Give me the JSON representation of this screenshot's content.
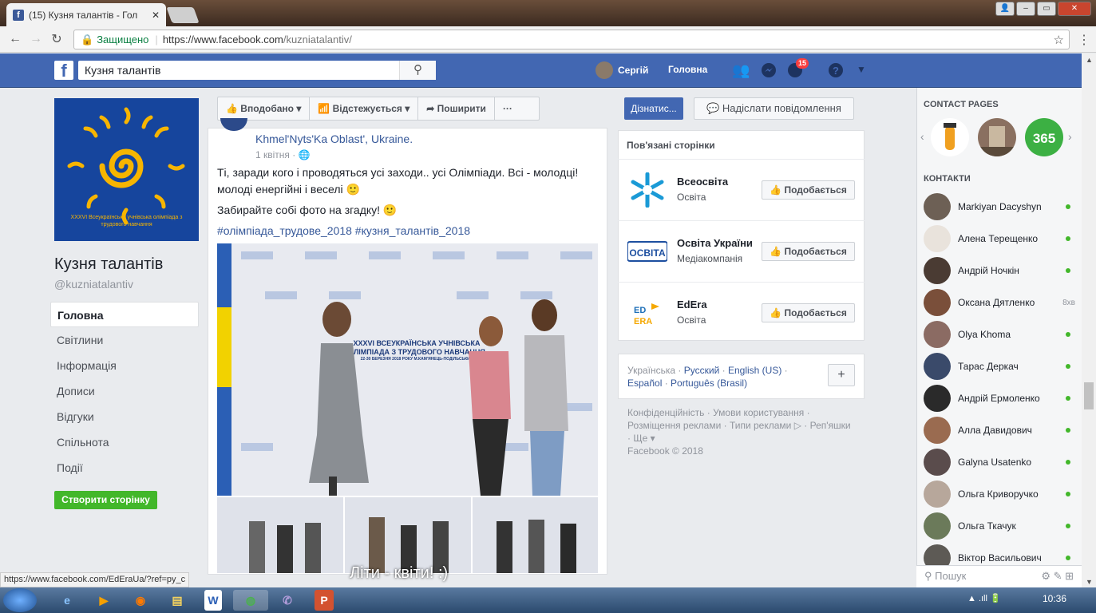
{
  "browser": {
    "tab_title": "(15) Кузня талантів - Гол",
    "secure_label": "Защищено",
    "url_host": "https://www.facebook.com",
    "url_path": "/kuzniatalantiv/",
    "status_url": "https://www.facebook.com/EdEraUa/?ref=py_c"
  },
  "topbar": {
    "search_value": "Кузня талантів",
    "user_name": "Сергій",
    "home_label": "Головна",
    "notif_count": "15"
  },
  "page": {
    "cover_text": "XXXVI Всеукраїнська учнівська олімпіада з трудового навчання",
    "name": "Кузня талантів",
    "handle": "@kuzniatalantiv",
    "nav": [
      "Головна",
      "Світлини",
      "Інформація",
      "Дописи",
      "Відгуки",
      "Спільнота",
      "Події"
    ],
    "create_page": "Створити сторінку"
  },
  "actions": {
    "liked": "Вподобано",
    "following": "Відстежується",
    "share": "Поширити",
    "more": "···",
    "learn_more": "Дізнатис...",
    "send_message": "Надіслати повідомлення"
  },
  "post": {
    "location": "Khmel'Nyts'Ka Oblast', Ukraine.",
    "date": "1 квітня",
    "text1": "Ті, заради кого і проводяться усі заходи.. усі Олімпіади. Всі - молодці! молоді енергійні і веселі 🙂",
    "text2": "Забирайте собі фото на згадку! 🙂",
    "tags": "#олімпіада_трудове_2018 #кузня_талантів_2018",
    "banner_text": "XXXVI ВСЕУКРАЇНСЬКА УЧНІВСЬКА ОЛІМПІАДА З ТРУДОВОГО НАВЧАННЯ",
    "banner_sub": "22-30 БЕРЕЗНЯ 2018 РОКУ М.КАМ'ЯНЕЦЬ-ПОДІЛЬСЬКИЙ",
    "overlay": "Літи - квіти! :)"
  },
  "related": {
    "header": "Пов'язані сторінки",
    "like_label": "Подобається",
    "items": [
      {
        "name": "Всеосвіта",
        "category": "Освіта"
      },
      {
        "name": "Освіта України",
        "category": "Медіакомпанія",
        "logo": "ОСВІТА"
      },
      {
        "name": "EdEra",
        "category": "Освіта",
        "logo": "ED ERA"
      }
    ]
  },
  "languages": {
    "current": "Українська",
    "links": [
      "Русский",
      "English (US)",
      "Español",
      "Português (Brasil)"
    ],
    "plus": "+"
  },
  "footer": {
    "line1": "Конфіденційність · Умови користування ·",
    "line2": "Розміщення реклами · Типи реклами ▷ · Реп'яшки",
    "line3": "· Ще ▾",
    "copyright": "Facebook © 2018"
  },
  "chat": {
    "contact_pages_title": "CONTACT PAGES",
    "contacts_title": "КОНТАКТИ",
    "page_365": "365",
    "contacts": [
      {
        "name": "Markiyan Dacyshyn",
        "time": ""
      },
      {
        "name": "Алена Терещенко",
        "time": ""
      },
      {
        "name": "Андрій Ночкін",
        "time": ""
      },
      {
        "name": "Оксана Дятленко",
        "time": "8хв"
      },
      {
        "name": "Olya Khoma",
        "time": ""
      },
      {
        "name": "Тарас Деркач",
        "time": ""
      },
      {
        "name": "Андрій Ермоленко",
        "time": ""
      },
      {
        "name": "Алла Давидович",
        "time": ""
      },
      {
        "name": "Galyna Usatenko",
        "time": ""
      },
      {
        "name": "Ольга Криворучко",
        "time": ""
      },
      {
        "name": "Ольга Ткачук",
        "time": ""
      },
      {
        "name": "Віктор Васильович",
        "time": ""
      }
    ],
    "search_placeholder": "Пошук"
  },
  "taskbar": {
    "time": "10:36"
  },
  "colors": {
    "fb_blue": "#4267b2",
    "link": "#365899",
    "online": "#42b72a",
    "create": "#42b72a"
  }
}
